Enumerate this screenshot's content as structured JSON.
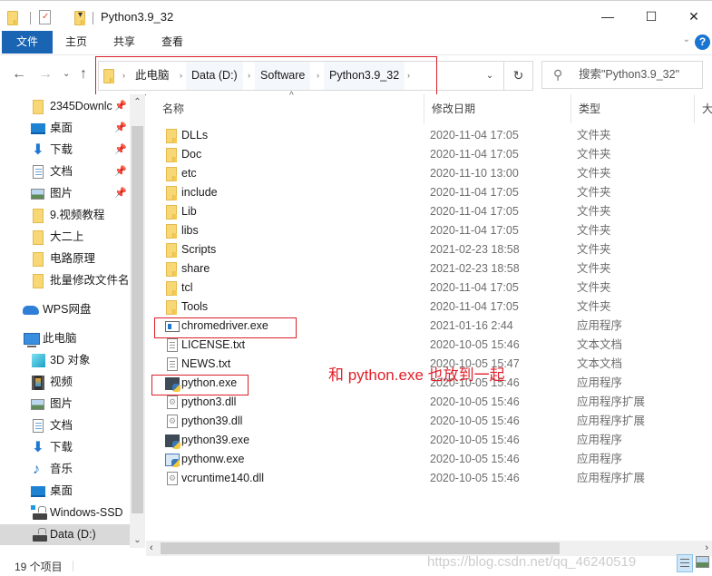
{
  "window": {
    "title": "Python3.9_32",
    "controls": {
      "minimize": "—",
      "maximize": "☐",
      "close": "✕"
    }
  },
  "quick_access_toolbar": {
    "icons": [
      "folder-icon",
      "properties-icon",
      "new-folder-icon"
    ],
    "dropdown": "▾"
  },
  "ribbon": {
    "tabs": [
      {
        "label": "文件",
        "active": true
      },
      {
        "label": "主页"
      },
      {
        "label": "共享"
      },
      {
        "label": "查看"
      }
    ],
    "expand_chevron": "⌄",
    "help": "?"
  },
  "navigation": {
    "back": "←",
    "forward": "→",
    "recent": "⌄",
    "up": "↑",
    "breadcrumbs": [
      "此电脑",
      "Data (D:)",
      "Software",
      "Python3.9_32"
    ],
    "crumb_separator": "›",
    "address_dropdown": "⌄",
    "refresh": "↻",
    "search_placeholder": "搜索\"Python3.9_32\""
  },
  "sidebar": {
    "items": [
      {
        "label": "2345Downlc",
        "icon": "folder-icon",
        "pinned": true,
        "indent": 1
      },
      {
        "label": "桌面",
        "icon": "desktop-icon",
        "pinned": true,
        "indent": 1
      },
      {
        "label": "下载",
        "icon": "download-icon",
        "pinned": true,
        "indent": 1
      },
      {
        "label": "文档",
        "icon": "document-icon",
        "pinned": true,
        "indent": 1
      },
      {
        "label": "图片",
        "icon": "picture-icon",
        "pinned": true,
        "indent": 1
      },
      {
        "label": "9.视频教程",
        "icon": "folder-icon",
        "indent": 1
      },
      {
        "label": "大二上",
        "icon": "folder-icon",
        "indent": 1
      },
      {
        "label": "电路原理",
        "icon": "folder-icon",
        "indent": 1
      },
      {
        "label": "批量修改文件名",
        "icon": "folder-icon",
        "indent": 1
      },
      {
        "label": "WPS网盘",
        "icon": "cloud-icon",
        "indent": 0
      },
      {
        "label": "此电脑",
        "icon": "computer-icon",
        "indent": 0
      },
      {
        "label": "3D 对象",
        "icon": "3d-objects-icon",
        "indent": 1
      },
      {
        "label": "视频",
        "icon": "video-icon",
        "indent": 1
      },
      {
        "label": "图片",
        "icon": "picture-icon",
        "indent": 1
      },
      {
        "label": "文档",
        "icon": "document-icon",
        "indent": 1
      },
      {
        "label": "下载",
        "icon": "download-icon",
        "indent": 1
      },
      {
        "label": "音乐",
        "icon": "music-icon",
        "indent": 1
      },
      {
        "label": "桌面",
        "icon": "desktop-icon",
        "indent": 1
      },
      {
        "label": "Windows-SSD",
        "icon": "windows-drive-icon",
        "indent": 1
      },
      {
        "label": "Data (D:)",
        "icon": "drive-icon",
        "indent": 1,
        "selected": true
      }
    ],
    "pin_glyph": "📌"
  },
  "columns": {
    "name": "名称",
    "date": "修改日期",
    "type": "类型",
    "size": "大小"
  },
  "files": [
    {
      "name": "DLLs",
      "date": "2020-11-04 17:05",
      "type": "文件夹",
      "icon": "folder"
    },
    {
      "name": "Doc",
      "date": "2020-11-04 17:05",
      "type": "文件夹",
      "icon": "folder"
    },
    {
      "name": "etc",
      "date": "2020-11-10 13:00",
      "type": "文件夹",
      "icon": "folder"
    },
    {
      "name": "include",
      "date": "2020-11-04 17:05",
      "type": "文件夹",
      "icon": "folder"
    },
    {
      "name": "Lib",
      "date": "2020-11-04 17:05",
      "type": "文件夹",
      "icon": "folder"
    },
    {
      "name": "libs",
      "date": "2020-11-04 17:05",
      "type": "文件夹",
      "icon": "folder"
    },
    {
      "name": "Scripts",
      "date": "2021-02-23 18:58",
      "type": "文件夹",
      "icon": "folder"
    },
    {
      "name": "share",
      "date": "2021-02-23 18:58",
      "type": "文件夹",
      "icon": "folder"
    },
    {
      "name": "tcl",
      "date": "2020-11-04 17:05",
      "type": "文件夹",
      "icon": "folder"
    },
    {
      "name": "Tools",
      "date": "2020-11-04 17:05",
      "type": "文件夹",
      "icon": "folder"
    },
    {
      "name": "chromedriver.exe",
      "date": "2021-01-16 2:44",
      "type": "应用程序",
      "icon": "app"
    },
    {
      "name": "LICENSE.txt",
      "date": "2020-10-05 15:46",
      "type": "文本文档",
      "icon": "txt"
    },
    {
      "name": "NEWS.txt",
      "date": "2020-10-05 15:47",
      "type": "文本文档",
      "icon": "txt"
    },
    {
      "name": "python.exe",
      "date": "2020-10-05 15:46",
      "type": "应用程序",
      "icon": "py"
    },
    {
      "name": "python3.dll",
      "date": "2020-10-05 15:46",
      "type": "应用程序扩展",
      "icon": "dll"
    },
    {
      "name": "python39.dll",
      "date": "2020-10-05 15:46",
      "type": "应用程序扩展",
      "icon": "dll"
    },
    {
      "name": "python39.exe",
      "date": "2020-10-05 15:46",
      "type": "应用程序",
      "icon": "py"
    },
    {
      "name": "pythonw.exe",
      "date": "2020-10-05 15:46",
      "type": "应用程序",
      "icon": "pyw"
    },
    {
      "name": "vcruntime140.dll",
      "date": "2020-10-05 15:46",
      "type": "应用程序扩展",
      "icon": "dll"
    }
  ],
  "annotation": {
    "text": "和 python.exe 也放到一起",
    "color": "#e0202a"
  },
  "scrollbars": {
    "up": "⌃",
    "down": "⌄",
    "left": "‹",
    "right": "›"
  },
  "status": {
    "item_count": "19 个项目"
  },
  "watermark": "https://blog.csdn.net/qq_46240519"
}
